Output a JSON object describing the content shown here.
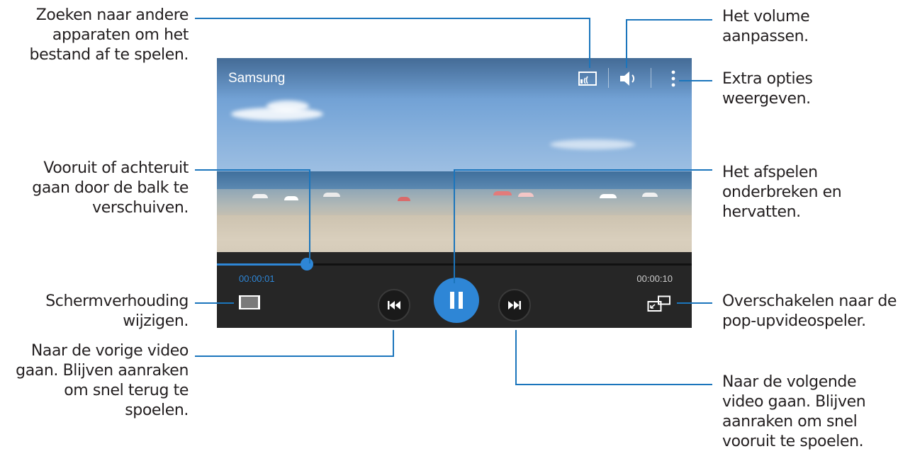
{
  "player": {
    "title": "Samsung",
    "elapsed": "00:00:01",
    "total": "00:00:10",
    "progress_fraction": 0.19
  },
  "callouts": {
    "search_devices": [
      "Zoeken naar andere",
      "apparaten om het",
      "bestand af te spelen."
    ],
    "volume": [
      "Het volume",
      "aanpassen."
    ],
    "more_options": [
      "Extra opties",
      "weergeven."
    ],
    "seek": [
      "Vooruit of achteruit",
      "gaan door de balk te",
      "verschuiven."
    ],
    "pause_resume": [
      "Het afspelen",
      "onderbreken en",
      "hervatten."
    ],
    "aspect_ratio": [
      "Schermverhouding",
      "wijzigen."
    ],
    "popup_player": [
      "Overschakelen naar de",
      "pop-upvideospeler."
    ],
    "previous": [
      "Naar de vorige video",
      "gaan. Blijven aanraken",
      "om snel terug te",
      "spoelen."
    ],
    "next": [
      "Naar de volgende",
      "video gaan. Blijven",
      "aanraken om snel",
      "vooruit te spoelen."
    ]
  },
  "icons": {
    "screen_mirroring": "screen-mirroring-icon",
    "volume": "volume-icon",
    "more": "more-options-icon",
    "aspect": "aspect-ratio-icon",
    "previous": "previous-icon",
    "pause": "pause-icon",
    "next": "next-icon",
    "popup": "popup-player-icon"
  },
  "colors": {
    "accent": "#2e86d6",
    "leader_line": "#1b75bc",
    "controls_bg": "#262626",
    "time_elapsed": "#2e86d6",
    "time_total": "#cccccc"
  }
}
